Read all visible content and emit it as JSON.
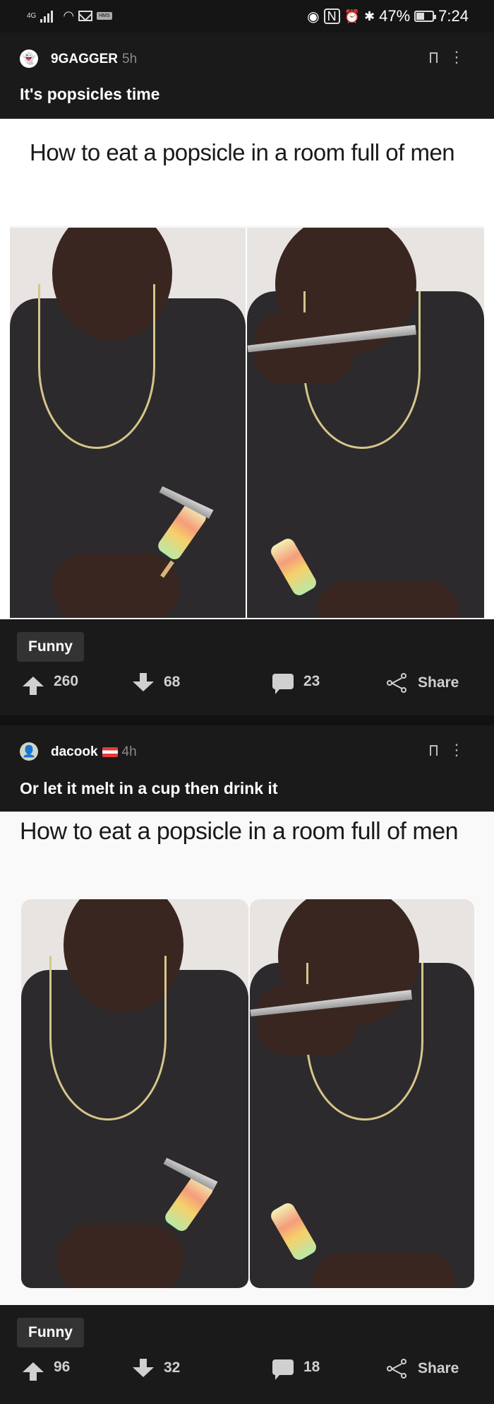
{
  "status_bar": {
    "network": "4G",
    "battery": "47%",
    "time": "7:24",
    "battery_level": 0.47,
    "icons": [
      "signal-icon",
      "wifi-icon",
      "mail-icon",
      "hms-icon",
      "eye-icon",
      "nfc-icon",
      "alarm-icon",
      "bluetooth-icon",
      "battery-icon"
    ]
  },
  "posts": [
    {
      "author": "9GAGGER",
      "time": "5h",
      "title": "It's popsicles time",
      "meme_caption": "How to eat a popsicle in a room full of men",
      "tag": "Funny",
      "upvotes": "260",
      "downvotes": "68",
      "comments": "23",
      "share": "Share"
    },
    {
      "author": "dacook",
      "time": "4h",
      "title": "Or let it melt in a cup then drink it",
      "meme_caption": "How to eat a popsicle in a room full of men",
      "tag": "Funny",
      "upvotes": "96",
      "downvotes": "32",
      "comments": "18",
      "share": "Share"
    }
  ],
  "colors": {
    "background": "#1a1a1a",
    "tag_bg": "#333333",
    "text": "#ffffff",
    "muted": "#8a8a8a"
  }
}
